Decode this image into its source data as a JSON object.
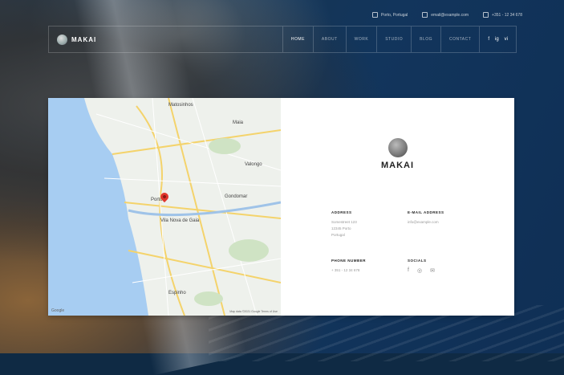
{
  "topbar": {
    "location": "Porto, Portugal",
    "email": "email@example.com",
    "phone": "+351 - 12 34 678"
  },
  "header": {
    "logo_text": "MAKAI",
    "nav": [
      "HOME",
      "ABOUT",
      "WORK",
      "STUDIO",
      "BLOG",
      "CONTACT"
    ],
    "active": "HOME",
    "socials": [
      "f",
      "ig",
      "vi"
    ]
  },
  "map": {
    "city": "Porto",
    "area_labels": [
      "Matosinhos",
      "Maia",
      "Gondomar",
      "Vila Nova de Gaia",
      "Valongo",
      "Espinho"
    ],
    "google": "Google",
    "footer": "Map data ©2021 Google  Terms of Use"
  },
  "contact": {
    "brand": "MAKAI",
    "address_title": "ADDRESS",
    "address_lines": [
      "Somestreet 123",
      "12345 Porto",
      "Portugal"
    ],
    "email_title": "E-MAIL ADDRESS",
    "email": "info@example.com",
    "phone_title": "PHONE NUMBER",
    "phone": "+ 351 - 12 34 678",
    "socials_title": "SOCIALS",
    "socials": [
      "f",
      "◎",
      "✉"
    ]
  }
}
